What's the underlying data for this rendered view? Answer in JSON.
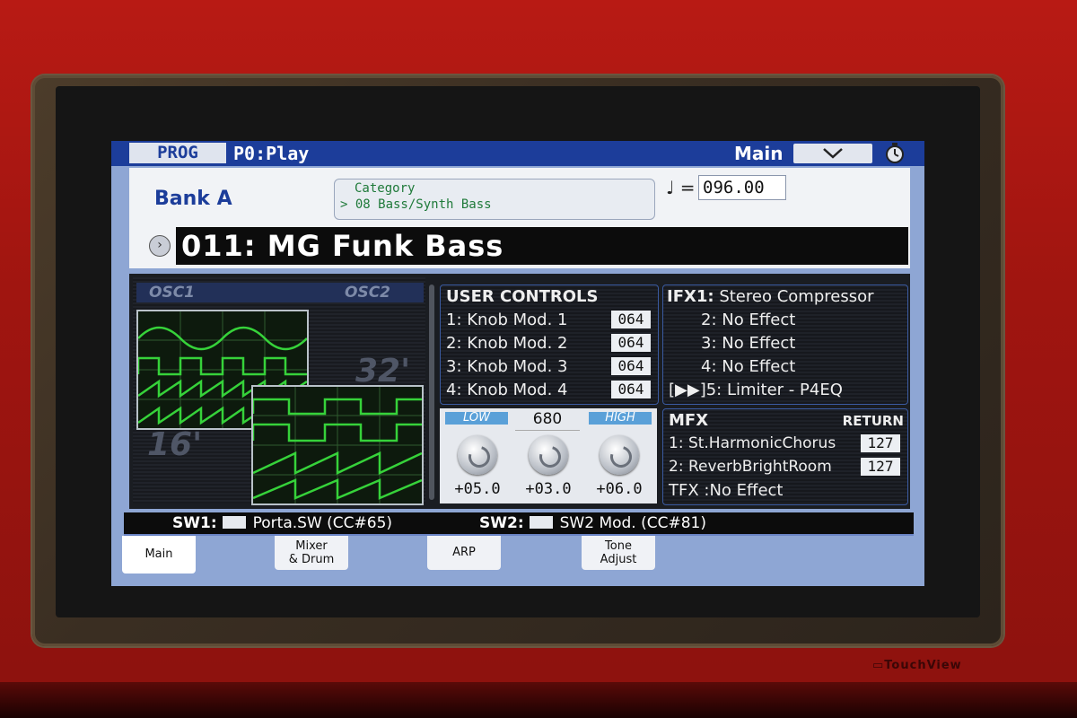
{
  "topbar": {
    "prog_tab": "PROG",
    "mode": "P0:Play",
    "page": "Main"
  },
  "header": {
    "bank": "Bank A",
    "category_title": "Category",
    "category_value": "> 08 Bass/Synth Bass",
    "tempo_symbol": "♩ =",
    "tempo": "096.00",
    "program_name": "011: MG Funk Bass"
  },
  "osc": {
    "osc1_label": "OSC1",
    "osc2_label": "OSC2",
    "len_32": "32'",
    "len_16": "16'"
  },
  "user_controls": {
    "title": "USER CONTROLS",
    "rows": [
      {
        "label": "1: Knob Mod. 1",
        "value": "064"
      },
      {
        "label": "2: Knob Mod. 2",
        "value": "064"
      },
      {
        "label": "3: Knob Mod. 3",
        "value": "064"
      },
      {
        "label": "4: Knob Mod. 4",
        "value": "064"
      }
    ]
  },
  "ifx": {
    "rows": [
      {
        "prefix": "IFX1:",
        "value": "Stereo Compressor"
      },
      {
        "prefix": "2:",
        "value": "No Effect"
      },
      {
        "prefix": "3:",
        "value": "No Effect"
      },
      {
        "prefix": "4:",
        "value": "No Effect"
      },
      {
        "prefix": "[▶▶]5:",
        "value": "Limiter - P4EQ"
      }
    ]
  },
  "eq": {
    "low_label": "LOW",
    "high_label": "HIGH",
    "mid_freq": "680",
    "low_val": "+05.0",
    "mid_val": "+03.0",
    "high_val": "+06.0"
  },
  "mfx": {
    "title": "MFX",
    "return_label": "RETURN",
    "rows": [
      {
        "label": "1: St.HarmonicChorus",
        "value": "127"
      },
      {
        "label": "2: ReverbBrightRoom",
        "value": "127"
      }
    ],
    "tfx": "TFX :No Effect"
  },
  "switches": {
    "sw1_label": "SW1:",
    "sw1_value": "Porta.SW  (CC#65)",
    "sw2_label": "SW2:",
    "sw2_value": "SW2 Mod. (CC#81)"
  },
  "tabs": {
    "main": "Main",
    "mixer_1": "Mixer",
    "mixer_2": "& Drum",
    "arp": "ARP",
    "tone_1": "Tone",
    "tone_2": "Adjust"
  },
  "colors": {
    "title_bar": "#1c3d9a",
    "wave_green": "#36d23a",
    "body_red": "#b81a14"
  }
}
